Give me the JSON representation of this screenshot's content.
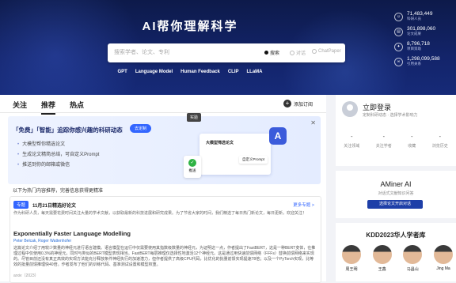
{
  "hero": {
    "title": "AI帮你理解科学",
    "search_placeholder": "搜索学者、论文、专利",
    "search_options": [
      "搜索",
      "对话",
      "ChatPaper"
    ],
    "hot_links": [
      "GPT",
      "Language Model",
      "Human Feedback",
      "CLIP",
      "LLaMA"
    ]
  },
  "stats": [
    {
      "icon": "people-icon",
      "value": "71,483,449",
      "label": "科研人员"
    },
    {
      "icon": "paper-icon",
      "value": "301,898,060",
      "label": "论文成果"
    },
    {
      "icon": "patent-icon",
      "value": "8,796,718",
      "label": "项目资助"
    },
    {
      "icon": "link-icon",
      "value": "1,298,099,588",
      "label": "引用关系"
    }
  ],
  "tabs": [
    "关注",
    "推荐",
    "热点"
  ],
  "subscribe_label": "添加订阅",
  "tooltip": "实验",
  "banner": {
    "title_prefix": "「免费」「智能」追踪你感兴趣的科研动态",
    "button": "去定制",
    "items": [
      "大模型帮你精选论文",
      "生成论文精简总结，可自定义Prompt",
      "推送到你的邮箱或微信"
    ],
    "card_title": "大模型筛选论文",
    "ok_label": "推送",
    "prompt_label": "自定义Prompt",
    "logo": "A"
  },
  "hot_header": "以下为热门内容推荐，完善信息获得更精准",
  "hot_card": {
    "tag": "专题",
    "date": "11月21日精选好论文",
    "more": "更多专题 >",
    "desc": "作为科研人员，每天需要花费时间关注大量的学术文献，以获取最新的科技进展和研究成果。为了节省大家的时间，我们精选了每日热门新论文，每日更新，欢迎关注！",
    "paper_title": "Exponentially Faster Language Modelling",
    "authors": "Peter Belcak, Roger Wattenhofer",
    "abstract": "这篇论文介绍了用较少数量的神经元进行语言建模。语言模型在运行中仅需要使用其指数级数量的神经元，为证明这一点，作者提出了FastBERT，这是一种BERT变体，在推理过程中仅使用0.3%的神经元，同时与类似的BERT模型表现相当。FastBERT每层推理仅选择性地激活12个神经元。这是通过用快速前馈网络（FFFs）替换前馈网络来实现的。尽管目前还没有真正高效的实现方法能充分释放条件神经执行的加速潜力，但作者提供了高级CPU代码，比优化的批量前馈实现提速78倍；以及一个PyTorch实现，比等效的批量前馈推理快40倍。作者发布了他们的训练代码、基准测试设置和模型权重。",
    "footer": "arxiv（2023）"
  },
  "login": {
    "title": "立即登录",
    "subtitle": "定制科研动态 · 选择学术影响力",
    "metrics": [
      {
        "value": "-",
        "label": "关注领域"
      },
      {
        "value": "-",
        "label": "关注学者"
      },
      {
        "value": "-",
        "label": "收藏"
      },
      {
        "value": "-",
        "label": "浏览历史"
      }
    ]
  },
  "aminer": {
    "title": "AMiner AI",
    "subtitle": "对话式文献知识问答",
    "button": "选择论文开启对话"
  },
  "kdd": {
    "title": "KDD2023华人学者库",
    "people": [
      "周王明",
      "王鑫",
      "马昌山",
      "Jing Ma"
    ]
  },
  "colors": {
    "hero_bg": "#13246a",
    "accent": "#3366ff",
    "button_dark": "#1e3fa8"
  }
}
